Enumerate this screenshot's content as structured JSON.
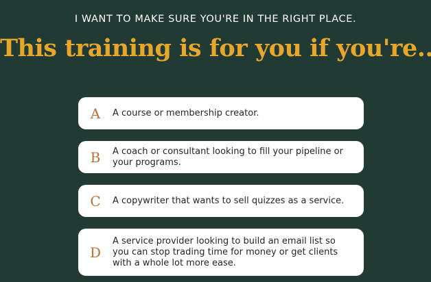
{
  "header": {
    "eyebrow": "I WANT TO MAKE SURE YOU'RE IN THE RIGHT PLACE.",
    "headline": "This training is for you if you're..."
  },
  "options": [
    {
      "letter": "A",
      "text": "A course or membership creator."
    },
    {
      "letter": "B",
      "text": "A coach or consultant looking to fill your pipeline or your programs."
    },
    {
      "letter": "C",
      "text": "A copywriter that wants to sell quizzes as a service."
    },
    {
      "letter": "D",
      "text": "A service provider looking to build an email list so you can stop trading time for money or get clients with a whole lot more ease."
    }
  ],
  "colors": {
    "background": "#213b34",
    "headline": "#e8a72c",
    "letter": "#b8703a",
    "card": "#ffffff"
  }
}
